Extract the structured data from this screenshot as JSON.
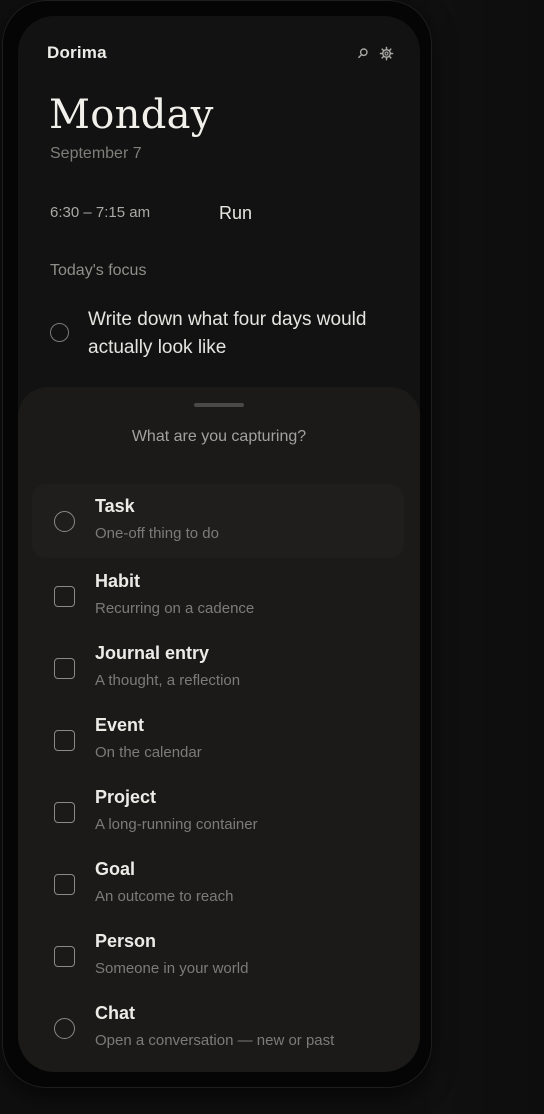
{
  "header": {
    "app_name": "Dorima",
    "search_icon": "search-icon",
    "settings_icon": "gear-icon"
  },
  "day": {
    "title": "Monday",
    "date": "September 7"
  },
  "event": {
    "time": "6:30 – 7:15 am",
    "title": "Run"
  },
  "focus": {
    "label": "Today's focus",
    "item": "Write down what four days would actually look like"
  },
  "sheet": {
    "title": "What are you capturing?",
    "options": [
      {
        "name": "Task",
        "description": "One-off thing to do",
        "icon": "circle-icon"
      },
      {
        "name": "Habit",
        "description": "Recurring on a cadence",
        "icon": "square-icon"
      },
      {
        "name": "Journal entry",
        "description": "A thought, a reflection",
        "icon": "square-icon"
      },
      {
        "name": "Event",
        "description": "On the calendar",
        "icon": "square-icon"
      },
      {
        "name": "Project",
        "description": "A long-running container",
        "icon": "square-icon"
      },
      {
        "name": "Goal",
        "description": "An outcome to reach",
        "icon": "square-icon"
      },
      {
        "name": "Person",
        "description": "Someone in your world",
        "icon": "square-icon"
      },
      {
        "name": "Chat",
        "description": "Open a conversation — new or past",
        "icon": "circle-icon"
      }
    ]
  },
  "colors": {
    "background": "#0f0f0f",
    "screen": "#121212",
    "sheet": "#1b1a19",
    "text_primary": "#ecebe6",
    "text_secondary": "#7c7b77"
  }
}
